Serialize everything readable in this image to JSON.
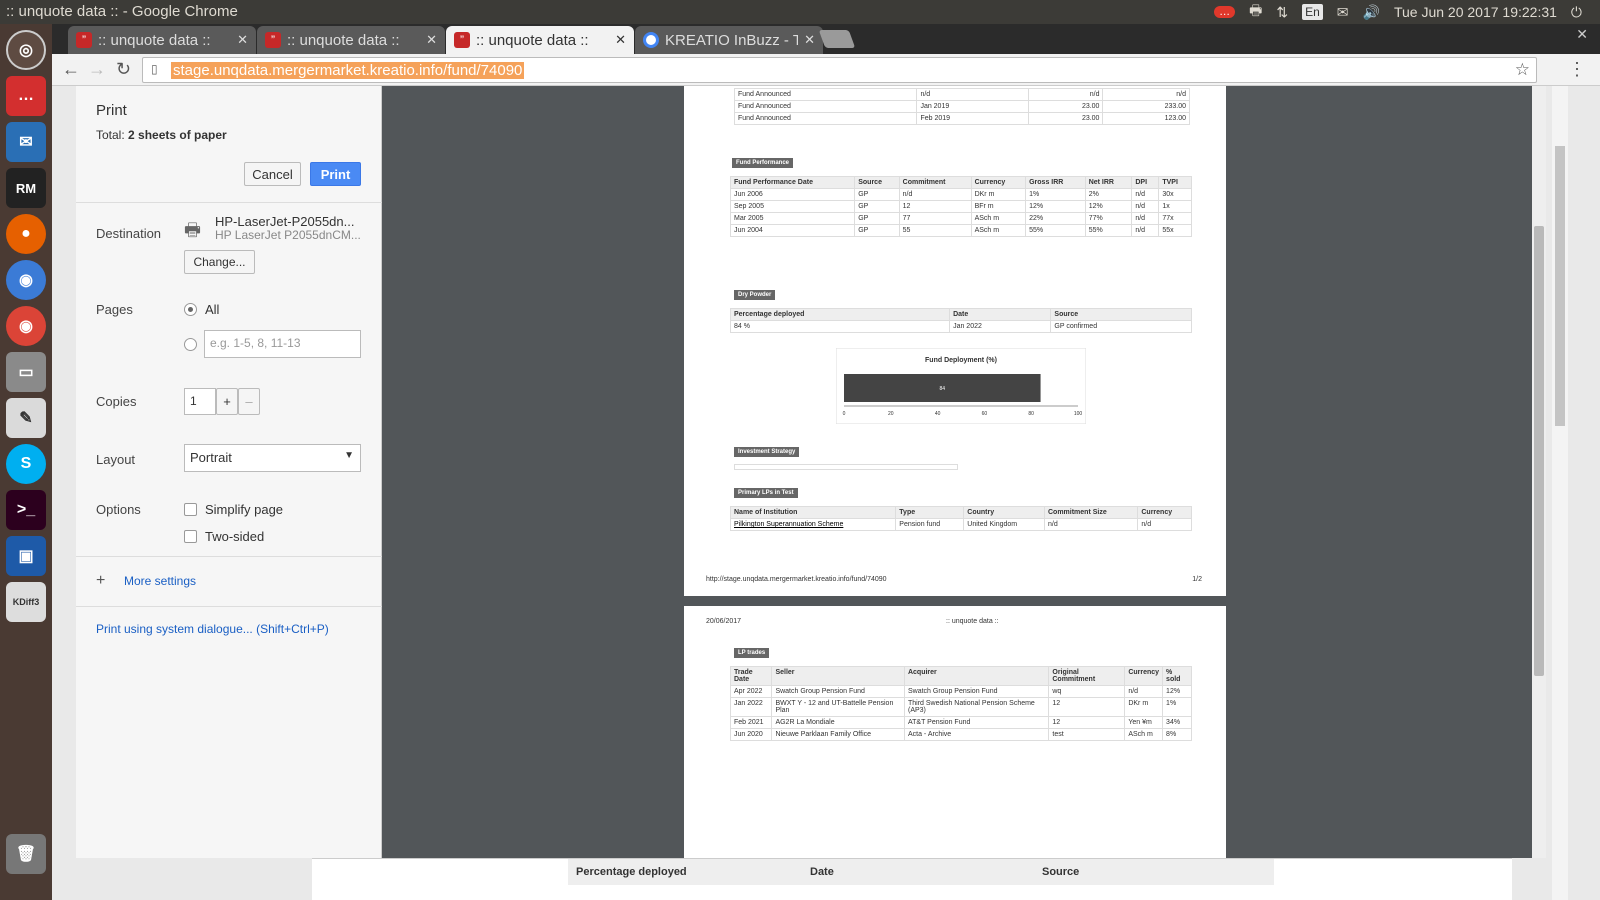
{
  "desktop": {
    "window_title": ":: unquote data :: - Google Chrome",
    "clock": "Tue Jun 20 2017 19:22:31",
    "lang": "En"
  },
  "launcher": {
    "items": [
      "dash-icon",
      "chat-icon",
      "thunderbird-icon",
      "rubymine-icon",
      "firefox-icon",
      "chromium-icon",
      "chrome-icon",
      "files-icon",
      "text-editor-icon",
      "skype-icon",
      "terminal-icon",
      "virtualbox-icon",
      "kdiff3-icon",
      "trash-icon"
    ],
    "rm_label": "RM",
    "kdiff_label": "KDiff3"
  },
  "tabs": [
    {
      "label": ":: unquote data ::",
      "icon": "quote-icon"
    },
    {
      "label": ":: unquote data ::",
      "icon": "quote-icon"
    },
    {
      "label": ":: unquote data ::",
      "icon": "quote-icon",
      "active": true
    },
    {
      "label": "KREATIO InBuzz - Ta",
      "icon": "google-icon"
    }
  ],
  "address": {
    "url": "stage.unqdata.mergermarket.kreatio.info/fund/74090"
  },
  "print": {
    "title": "Print",
    "total_prefix": "Total: ",
    "total_value": "2 sheets of paper",
    "cancel": "Cancel",
    "print": "Print",
    "destination_label": "Destination",
    "printer_name": "HP-LaserJet-P2055dn...",
    "printer_sub": "HP LaserJet P2055dnCM...",
    "change": "Change...",
    "pages_label": "Pages",
    "pages_all": "All",
    "pages_placeholder": "e.g. 1-5, 8, 11-13",
    "copies_label": "Copies",
    "copies_value": "1",
    "plus": "+",
    "minus": "–",
    "layout_label": "Layout",
    "layout_value": "Portrait",
    "options_label": "Options",
    "opt_simplify": "Simplify page",
    "opt_twosided": "Two-sided",
    "more_settings": "More settings",
    "system_dialog": "Print using system dialogue... (Shift+Ctrl+P)"
  },
  "preview": {
    "page_badge": "1",
    "announced_rows": [
      [
        "Fund Announced",
        "n/d",
        "n/d",
        "n/d"
      ],
      [
        "Fund Announced",
        "Jan 2019",
        "23.00",
        "233.00"
      ],
      [
        "Fund Announced",
        "Feb 2019",
        "23.00",
        "123.00"
      ]
    ],
    "fund_perf": {
      "section": "Fund Performance",
      "headers": [
        "Fund Performance Date",
        "Source",
        "Commitment",
        "Currency",
        "Gross IRR",
        "Net IRR",
        "DPI",
        "TVPI"
      ],
      "rows": [
        [
          "Jun 2006",
          "GP",
          "n/d",
          "DKr m",
          "1%",
          "2%",
          "n/d",
          "30x"
        ],
        [
          "Sep 2005",
          "GP",
          "12",
          "BFr m",
          "12%",
          "12%",
          "n/d",
          "1x"
        ],
        [
          "Mar 2005",
          "GP",
          "77",
          "ASch m",
          "22%",
          "77%",
          "n/d",
          "77x"
        ],
        [
          "Jun 2004",
          "GP",
          "55",
          "ASch m",
          "55%",
          "55%",
          "n/d",
          "55x"
        ]
      ]
    },
    "dry_powder": {
      "section": "Dry Powder",
      "headers": [
        "Percentage deployed",
        "Date",
        "Source"
      ],
      "row": [
        "84 %",
        "Jan 2022",
        "GP confirmed"
      ]
    },
    "chart": {
      "title": "Fund Deployment (%)",
      "ticks": [
        "0",
        "20",
        "40",
        "60",
        "80",
        "100"
      ]
    },
    "chart_data": {
      "type": "bar",
      "title": "Fund Deployment (%)",
      "categories": [
        ""
      ],
      "values": [
        84
      ],
      "xlim": [
        0,
        100
      ],
      "data_labels": [
        "84"
      ]
    },
    "investment_strategy": "Investment Strategy",
    "primary_lps": {
      "section": "Primary LPs in Test",
      "headers": [
        "Name of Institution",
        "Type",
        "Country",
        "Commitment Size",
        "Currency"
      ],
      "row": [
        "Pilkington Superannuation Scheme",
        "Pension fund",
        "United Kingdom",
        "n/d",
        "n/d"
      ]
    },
    "footer_url": "http://stage.unqdata.mergermarket.kreatio.info/fund/74090",
    "footer_page": "1/2",
    "page2_date": "20/06/2017",
    "page2_title": ":: unquote data ::",
    "lp_trades": {
      "section": "LP trades",
      "headers": [
        "Trade Date",
        "Seller",
        "Acquirer",
        "Original Commitment",
        "Currency",
        "% sold"
      ],
      "rows": [
        [
          "Apr 2022",
          "Swatch Group Pension Fund",
          "Swatch Group Pension Fund",
          "wq",
          "n/d",
          "12%"
        ],
        [
          "Jan 2022",
          "BWXT Y - 12 and UT-Battelle Pension Plan",
          "Third Swedish National Pension Scheme (AP3)",
          "12",
          "DKr m",
          "1%"
        ],
        [
          "Feb 2021",
          "AG2R La Mondiale",
          "AT&T Pension Fund",
          "12",
          "Yen ¥m",
          "34%"
        ],
        [
          "Jun 2020",
          "Nieuwe Parklaan Family Office",
          "Acta - Archive",
          "test",
          "ASch m",
          "8%"
        ]
      ]
    }
  },
  "underlying": {
    "col1": "Percentage deployed",
    "col2": "Date",
    "col3": "Source"
  }
}
